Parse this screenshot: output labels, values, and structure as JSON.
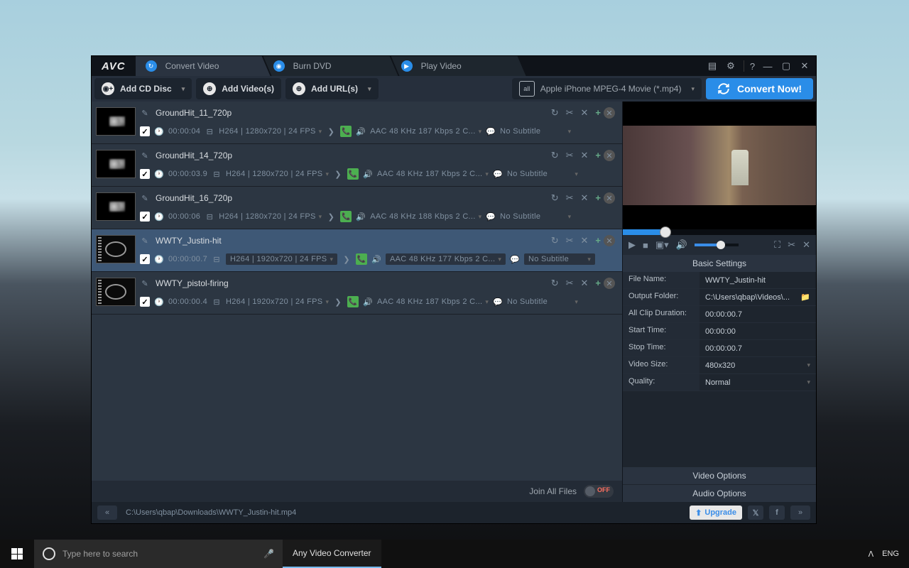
{
  "logo": "AVC",
  "title_tabs": [
    {
      "label": "Convert Video",
      "icon": "refresh"
    },
    {
      "label": "Burn DVD",
      "icon": "disc"
    },
    {
      "label": "Play Video",
      "icon": "play"
    }
  ],
  "toolbar": {
    "add_cd": "Add CD Disc",
    "add_videos": "Add Video(s)",
    "add_urls": "Add URL(s)",
    "format": "Apple iPhone MPEG-4 Movie (*.mp4)",
    "convert": "Convert Now!"
  },
  "files": [
    {
      "name": "GroundHit_11_720p",
      "duration": "00:00:04",
      "vinfo": "H264 | 1280x720 | 24 FPS",
      "audio": "AAC 48 KHz 187 Kbps 2 C...",
      "subtitle": "No Subtitle",
      "selected": false,
      "thumb": "smoke"
    },
    {
      "name": "GroundHit_14_720p",
      "duration": "00:00:03.9",
      "vinfo": "H264 | 1280x720 | 24 FPS",
      "audio": "AAC 48 KHz 187 Kbps 2 C...",
      "subtitle": "No Subtitle",
      "selected": false,
      "thumb": "smoke"
    },
    {
      "name": "GroundHit_16_720p",
      "duration": "00:00:06",
      "vinfo": "H264 | 1280x720 | 24 FPS",
      "audio": "AAC 48 KHz 188 Kbps 2 C...",
      "subtitle": "No Subtitle",
      "selected": false,
      "thumb": "smoke"
    },
    {
      "name": "WWTY_Justin-hit",
      "duration": "00:00:00.7",
      "vinfo": "H264 | 1920x720 | 24 FPS",
      "audio": "AAC 48 KHz 177 Kbps 2 C...",
      "subtitle": "No Subtitle",
      "selected": true,
      "thumb": "film"
    },
    {
      "name": "WWTY_pistol-firing",
      "duration": "00:00:00.4",
      "vinfo": "H264 | 1920x720 | 24 FPS",
      "audio": "AAC 48 KHz 187 Kbps 2 C...",
      "subtitle": "No Subtitle",
      "selected": false,
      "thumb": "film"
    }
  ],
  "join_all": "Join All Files",
  "join_state": "OFF",
  "settings_header": "Basic Settings",
  "settings": [
    {
      "label": "File Name:",
      "value": "WWTY_Justin-hit",
      "type": "text"
    },
    {
      "label": "Output Folder:",
      "value": "C:\\Users\\qbap\\Videos\\...",
      "type": "folder"
    },
    {
      "label": "All Clip Duration:",
      "value": "00:00:00.7",
      "type": "text"
    },
    {
      "label": "Start Time:",
      "value": "00:00:00",
      "type": "text"
    },
    {
      "label": "Stop Time:",
      "value": "00:00:00.7",
      "type": "text"
    },
    {
      "label": "Video Size:",
      "value": "480x320",
      "type": "dd"
    },
    {
      "label": "Quality:",
      "value": "Normal",
      "type": "dd"
    }
  ],
  "video_options": "Video Options",
  "audio_options": "Audio Options",
  "status_path": "C:\\Users\\qbap\\Downloads\\WWTY_Justin-hit.mp4",
  "upgrade": "Upgrade",
  "taskbar": {
    "search_placeholder": "Type here to search",
    "app": "Any Video Converter",
    "lang": "ENG"
  }
}
